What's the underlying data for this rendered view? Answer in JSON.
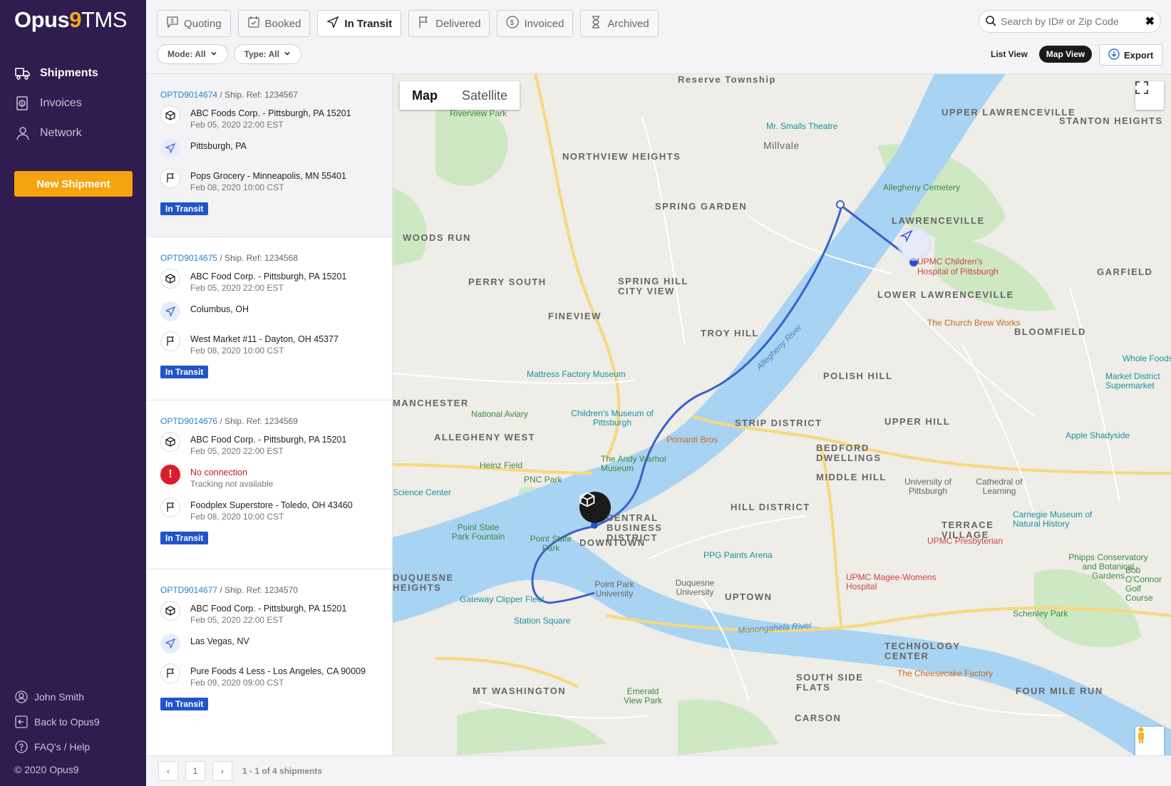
{
  "app": {
    "logo_opus": "Opus",
    "logo_nine": "9",
    "logo_tms": "TMS"
  },
  "sidebar": {
    "nav": [
      {
        "label": "Shipments",
        "icon": "truck-icon"
      },
      {
        "label": "Invoices",
        "icon": "invoice-icon"
      },
      {
        "label": "Network",
        "icon": "network-icon"
      }
    ],
    "new_shipment": "New Shipment",
    "bottom": [
      {
        "label": "John Smith",
        "icon": "user-icon"
      },
      {
        "label": "Back to Opus9",
        "icon": "back-icon"
      },
      {
        "label": "FAQ's / Help",
        "icon": "help-icon"
      }
    ],
    "copyright": "© 2020 Opus9"
  },
  "tabs": [
    {
      "label": "Quoting",
      "icon": "quote-icon"
    },
    {
      "label": "Booked",
      "icon": "calendar-check-icon"
    },
    {
      "label": "In Transit",
      "icon": "navigation-icon"
    },
    {
      "label": "Delivered",
      "icon": "flag-icon"
    },
    {
      "label": "Invoiced",
      "icon": "dollar-icon"
    },
    {
      "label": "Archived",
      "icon": "hourglass-icon"
    }
  ],
  "search": {
    "placeholder": "Search by ID# or Zip Code"
  },
  "filters": {
    "mode": "Mode: All",
    "type": "Type: All"
  },
  "views": {
    "list": "List View",
    "map": "Map View",
    "export": "Export"
  },
  "shipments": [
    {
      "id": "OPTD9014674",
      "ref": "/ Ship. Ref: 1234567",
      "origin": "ABC Foods Corp. - Pittsburgh, PA 15201",
      "origin_time": "Feb 05, 2020 22:00 EST",
      "current": "Pittsburgh, PA",
      "current_sub": "",
      "dest": "Pops Grocery - Minneapolis, MN 55401",
      "dest_time": "Feb 08, 2020 10:00 CST",
      "status": "In Transit"
    },
    {
      "id": "OPTD9014675",
      "ref": "/ Ship. Ref: 1234568",
      "origin": "ABC Food Corp. - Pittsburgh, PA 15201",
      "origin_time": "Feb 05, 2020 22:00 EST",
      "current": "Columbus, OH",
      "current_sub": "",
      "dest": "West Market #11 - Dayton, OH 45377",
      "dest_time": "Feb 08, 2020 10:00 CST",
      "status": "In Transit"
    },
    {
      "id": "OPTD9014676",
      "ref": "/ Ship. Ref: 1234569",
      "origin": "ABC Food Corp. - Pittsburgh, PA 15201",
      "origin_time": "Feb 05, 2020 22:00 EST",
      "current": "No connection",
      "current_sub": "Tracking not available",
      "dest": "Foodplex Superstore - Toledo, OH 43460",
      "dest_time": "Feb 08, 2020 10:00 CST",
      "status": "In Transit"
    },
    {
      "id": "OPTD9014677",
      "ref": "/ Ship. Ref: 1234570",
      "origin": "ABC Food Corp. - Pittsburgh, PA 15201",
      "origin_time": "Feb 05, 2020 22:00 EST",
      "current": "Las Vegas, NV",
      "current_sub": "",
      "dest": "Pure Foods 4 Less - Los Angeles, CA 90009",
      "dest_time": "Feb 09, 2020 09:00 CST",
      "status": "In Transit"
    }
  ],
  "map": {
    "toggle_map": "Map",
    "toggle_satellite": "Satellite",
    "areas": [
      "Reserve Township",
      "UPPER LAWRENCEVILLE",
      "STANTON HEIGHTS",
      "NORTHVIEW HEIGHTS",
      "Millvale",
      "SPRING GARDEN",
      "LAWRENCEVILLE",
      "WOODS RUN",
      "PERRY SOUTH",
      "SPRING HILL CITY VIEW",
      "GARFIELD",
      "LOWER LAWRENCEVILLE",
      "FINEVIEW",
      "TROY HILL",
      "BLOOMFIELD",
      "POLISH HILL",
      "MANCHESTER",
      "STRIP DISTRICT",
      "UPPER HILL",
      "ALLEGHENY WEST",
      "BEDFORD DWELLINGS",
      "MIDDLE HILL",
      "CENTRAL BUSINESS DISTRICT",
      "DOWNTOWN",
      "HILL DISTRICT",
      "TERRACE VILLAGE",
      "DUQUESNE HEIGHTS",
      "UPTOWN",
      "TECHNOLOGY CENTER",
      "SOUTH SIDE FLATS",
      "MT WASHINGTON",
      "FOUR MILE RUN",
      "CARSON"
    ],
    "pois": [
      "Riverview Park",
      "Mr. Smalls Theatre",
      "Allegheny Cemetery",
      "UPMC Children's Hospital of Pittsburgh",
      "The Church Brew Works",
      "Mattress Factory Museum",
      "National Aviary",
      "Children's Museum of Pittsburgh",
      "Primanti Bros",
      "Heinz Field",
      "The Andy Warhol Museum",
      "PNC Park",
      "Science Center",
      "Point State Park Fountain",
      "Point State Park",
      "PPG Paints Arena",
      "UPMC Presbyterian",
      "Carnegie Museum of Natural History",
      "Phipps Conservatory and Botanical Gardens",
      "UPMC Magee-Womens Hospital",
      "Gateway Clipper Fleet",
      "Station Square",
      "Point Park University",
      "Duquesne University",
      "The Cheesecake Factory",
      "Emerald View Park",
      "University of Pittsburgh",
      "Cathedral of Learning",
      "Schenley Park",
      "Bob O'Connor Golf Course",
      "Whole Foods",
      "Market District Supermarket",
      "Apple Shadyside",
      "Allegheny River",
      "Monongahela River"
    ]
  },
  "pager": {
    "page": "1",
    "info": "1 - 1 of 4 shipments"
  }
}
